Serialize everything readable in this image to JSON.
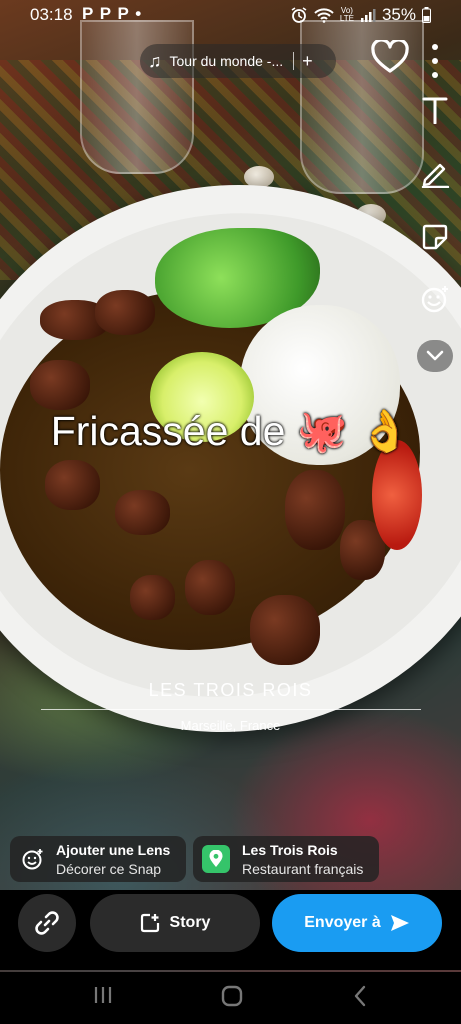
{
  "status_bar": {
    "time": "03:18",
    "notifications": "P P P •",
    "vol_top": "Vo)",
    "vol_bottom": "LTE",
    "battery": "35%"
  },
  "music": {
    "title": "Tour du monde -..."
  },
  "caption": {
    "text": "Fricassée de 🐙 👌"
  },
  "venue": {
    "name": "LES TROIS ROIS",
    "location": "Marseille, France"
  },
  "cards": {
    "lens_title": "Ajouter une Lens",
    "lens_subtitle": "Décorer ce Snap",
    "place_title": "Les Trois Rois",
    "place_subtitle": "Restaurant français"
  },
  "actions": {
    "story_label": "Story",
    "send_label": "Envoyer à"
  },
  "colors": {
    "send_button": "#1a9cf2",
    "place_pin": "#35c46a"
  }
}
